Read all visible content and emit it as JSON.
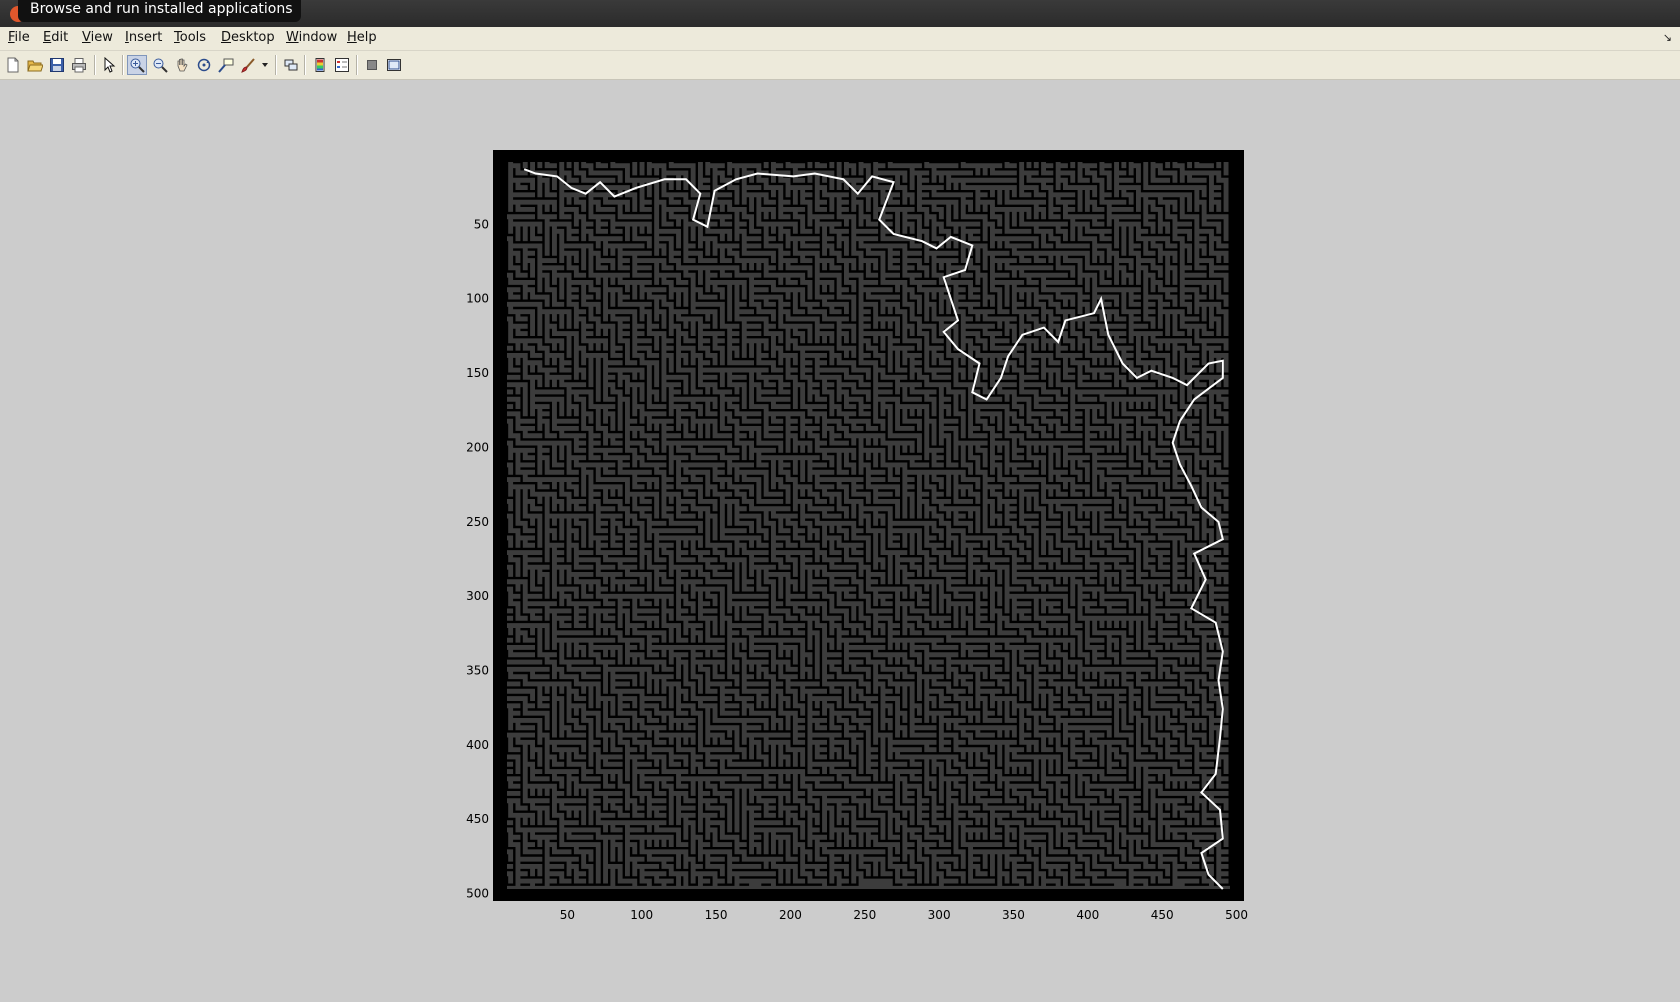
{
  "tooltip": "Browse and run installed applications",
  "menu": [
    {
      "label": "File",
      "u": "F",
      "rest": "ile"
    },
    {
      "label": "Edit",
      "u": "E",
      "rest": "dit"
    },
    {
      "label": "View",
      "u": "V",
      "rest": "iew"
    },
    {
      "label": "Insert",
      "u": "I",
      "rest": "nsert"
    },
    {
      "label": "Tools",
      "u": "T",
      "rest": "ools"
    },
    {
      "label": "Desktop",
      "u": "D",
      "rest": "esktop"
    },
    {
      "label": "Window",
      "u": "W",
      "rest": "indow"
    },
    {
      "label": "Help",
      "u": "H",
      "rest": "elp"
    }
  ],
  "toolbar": {
    "icons": [
      "new-figure-icon",
      "open-file-icon",
      "save-icon",
      "print-icon",
      "select-arrow-icon",
      "zoom-in-icon",
      "zoom-out-icon",
      "pan-hand-icon",
      "rotate-3d-icon",
      "data-cursor-icon",
      "brush-icon",
      "dropdown-arrow-icon",
      "link-plot-icon",
      "colorbar-icon",
      "legend-icon",
      "hide-plot-tools-icon",
      "show-plot-tools-icon"
    ],
    "active": "zoom-in-icon"
  },
  "axes": {
    "x_ticks": [
      "50",
      "100",
      "150",
      "200",
      "250",
      "300",
      "350",
      "400",
      "450",
      "500"
    ],
    "y_ticks": [
      "50",
      "100",
      "150",
      "200",
      "250",
      "300",
      "350",
      "400",
      "450",
      "500"
    ],
    "xlim": [
      0,
      505
    ],
    "ylim": [
      0,
      505
    ]
  },
  "colors": {
    "maze_wall": "#000000",
    "maze_path": "#3c3c3c",
    "solution": "#ffffff"
  }
}
